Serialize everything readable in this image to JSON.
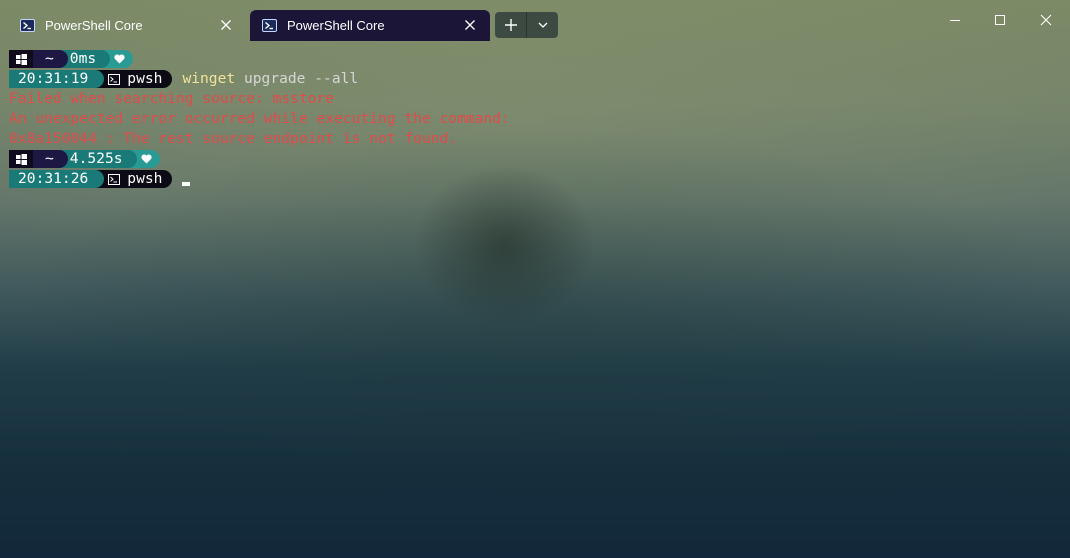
{
  "window": {
    "tabs": [
      {
        "title": "PowerShell Core",
        "active": false
      },
      {
        "title": "PowerShell Core",
        "active": true
      }
    ],
    "icons": {
      "tab_icon": "powershell-icon",
      "tab_close": "close-icon",
      "new_tab": "plus-icon",
      "dropdown": "chevron-down-icon",
      "minimize": "minimize-icon",
      "maximize": "maximize-icon",
      "close": "close-icon"
    }
  },
  "terminal": {
    "prompt1": {
      "path": "~",
      "elapsed": "0ms",
      "time": "20:31:19",
      "shell": "pwsh"
    },
    "command": {
      "name": "winget",
      "args": " upgrade --all"
    },
    "errors": [
      "Failed when searching source: msstore",
      "An unexpected error occurred while executing the command:",
      "0x8a150044 : The rest source endpoint is not found."
    ],
    "prompt2": {
      "path": "~",
      "elapsed": "4.525s",
      "time": "20:31:26",
      "shell": "pwsh"
    }
  },
  "colors": {
    "tab_active_bg": "#1b1538",
    "error_text": "#e24b4b",
    "command_text": "#f2e39a",
    "segment_teal": "#1a7a77",
    "segment_teal_light": "#2a9b94",
    "segment_purple": "#1d1744"
  }
}
